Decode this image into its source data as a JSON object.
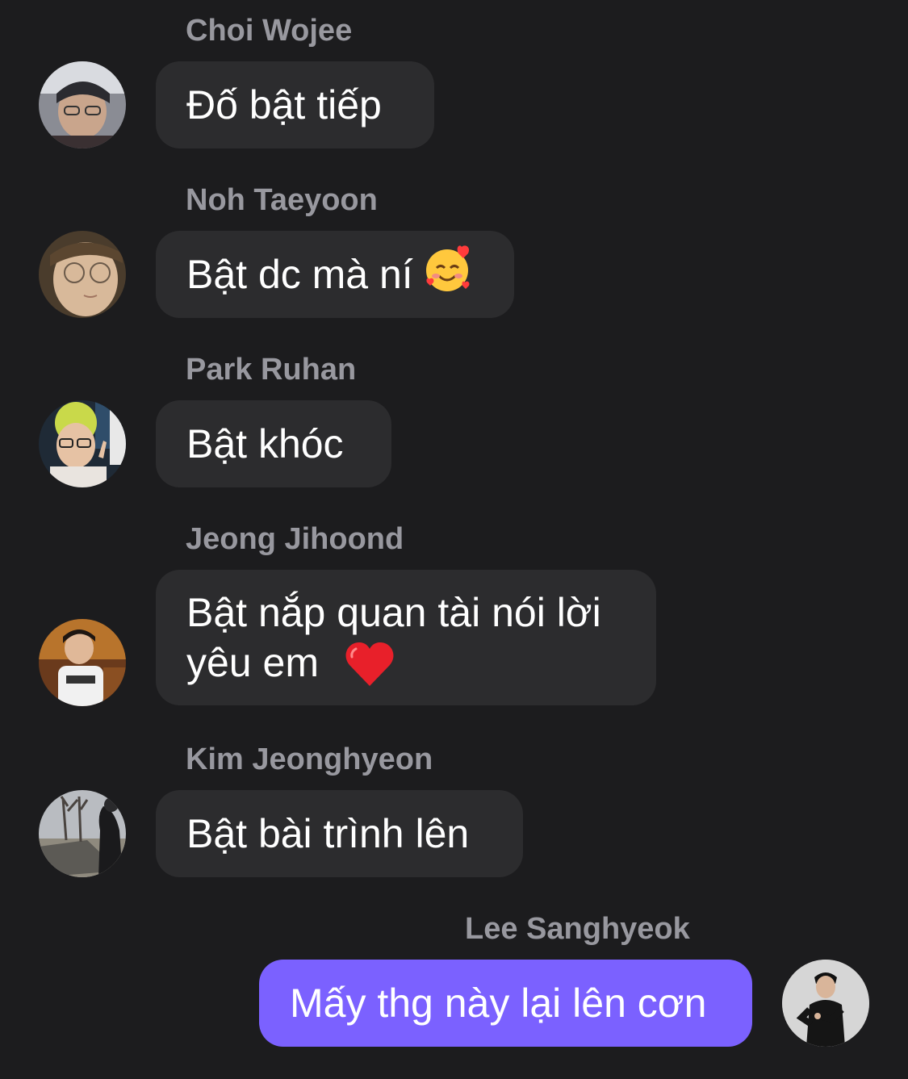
{
  "messages": [
    {
      "sender": "Choi Wojee",
      "text": "Đố bật tiếp",
      "avatar_icon": "user-photo-avatar"
    },
    {
      "sender": "Noh Taeyoon",
      "text": "Bật dc mà ní",
      "emoji_icon": "smiling-face-with-hearts-emoji",
      "avatar_icon": "user-photo-avatar"
    },
    {
      "sender": "Park Ruhan",
      "text": "Bật khóc",
      "avatar_icon": "user-photo-avatar"
    },
    {
      "sender": "Jeong Jihoond",
      "text": "Bật nắp quan tài nói lời\nyêu em",
      "emoji_icon": "red-heart-emoji",
      "avatar_icon": "user-photo-avatar"
    },
    {
      "sender": "Kim Jeonghyeon",
      "text": "Bật bài trình lên",
      "avatar_icon": "user-photo-avatar"
    },
    {
      "sender": "Lee Sanghyeok",
      "text": "Mấy thg này lại lên cơn",
      "avatar_icon": "user-photo-avatar",
      "outgoing": true
    }
  ],
  "colors": {
    "background": "#1c1c1e",
    "incoming_bubble": "#2c2c2e",
    "outgoing_bubble": "#7b61ff",
    "sender_name": "#98989f",
    "message_text": "#ffffff"
  }
}
